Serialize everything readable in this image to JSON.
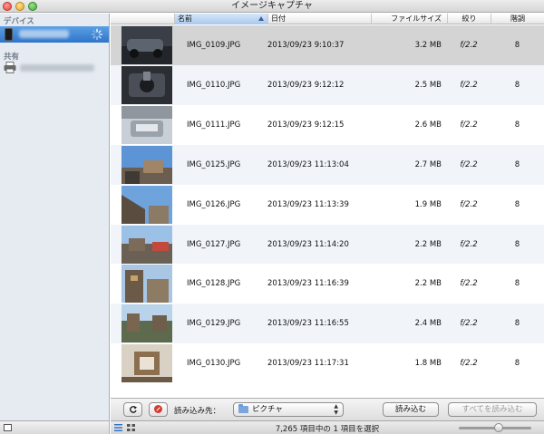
{
  "window": {
    "title": "イメージキャプチャ"
  },
  "sidebar": {
    "devices_heading": "デバイス",
    "device_name": "",
    "shared_heading": "共有",
    "printer_name": ""
  },
  "columns": {
    "name": "名前",
    "date": "日付",
    "size": "ファイルサイズ",
    "aperture": "絞り",
    "bits": "階調"
  },
  "rows": [
    {
      "name": "IMG_0109.JPG",
      "date": "2013/09/23 9:10:37",
      "size": "3.2 MB",
      "aperture": "f/2.2",
      "bits": "8",
      "selected": true
    },
    {
      "name": "IMG_0110.JPG",
      "date": "2013/09/23 9:12:12",
      "size": "2.5 MB",
      "aperture": "f/2.2",
      "bits": "8"
    },
    {
      "name": "IMG_0111.JPG",
      "date": "2013/09/23 9:12:15",
      "size": "2.6 MB",
      "aperture": "f/2.2",
      "bits": "8"
    },
    {
      "name": "IMG_0125.JPG",
      "date": "2013/09/23 11:13:04",
      "size": "2.7 MB",
      "aperture": "f/2.2",
      "bits": "8"
    },
    {
      "name": "IMG_0126.JPG",
      "date": "2013/09/23 11:13:39",
      "size": "1.9 MB",
      "aperture": "f/2.2",
      "bits": "8"
    },
    {
      "name": "IMG_0127.JPG",
      "date": "2013/09/23 11:14:20",
      "size": "2.2 MB",
      "aperture": "f/2.2",
      "bits": "8"
    },
    {
      "name": "IMG_0128.JPG",
      "date": "2013/09/23 11:16:39",
      "size": "2.2 MB",
      "aperture": "f/2.2",
      "bits": "8"
    },
    {
      "name": "IMG_0129.JPG",
      "date": "2013/09/23 11:16:55",
      "size": "2.4 MB",
      "aperture": "f/2.2",
      "bits": "8"
    },
    {
      "name": "IMG_0130.JPG",
      "date": "2013/09/23 11:17:31",
      "size": "1.8 MB",
      "aperture": "f/2.2",
      "bits": "8"
    }
  ],
  "import_bar": {
    "import_to_label": "読み込み先：",
    "destination": "ピクチャ",
    "import_label": "読み込む",
    "import_all_label": "すべてを読み込む"
  },
  "status": {
    "text": "7,265 項目中の 1 項目を選択"
  },
  "zoom": {
    "level": 0.55
  },
  "icons": {
    "rotate": "rotate-left-icon",
    "delete": "delete-icon",
    "folder": "folder-icon",
    "device": "iphone-icon",
    "printer": "printer-icon",
    "spinner": "spinner-icon"
  },
  "colors": {
    "selection_sidebar": "#3b82d3",
    "selection_row": "#d4d4d4",
    "alt_row": "#f1f5fa",
    "delete_red": "#d23b2f"
  }
}
